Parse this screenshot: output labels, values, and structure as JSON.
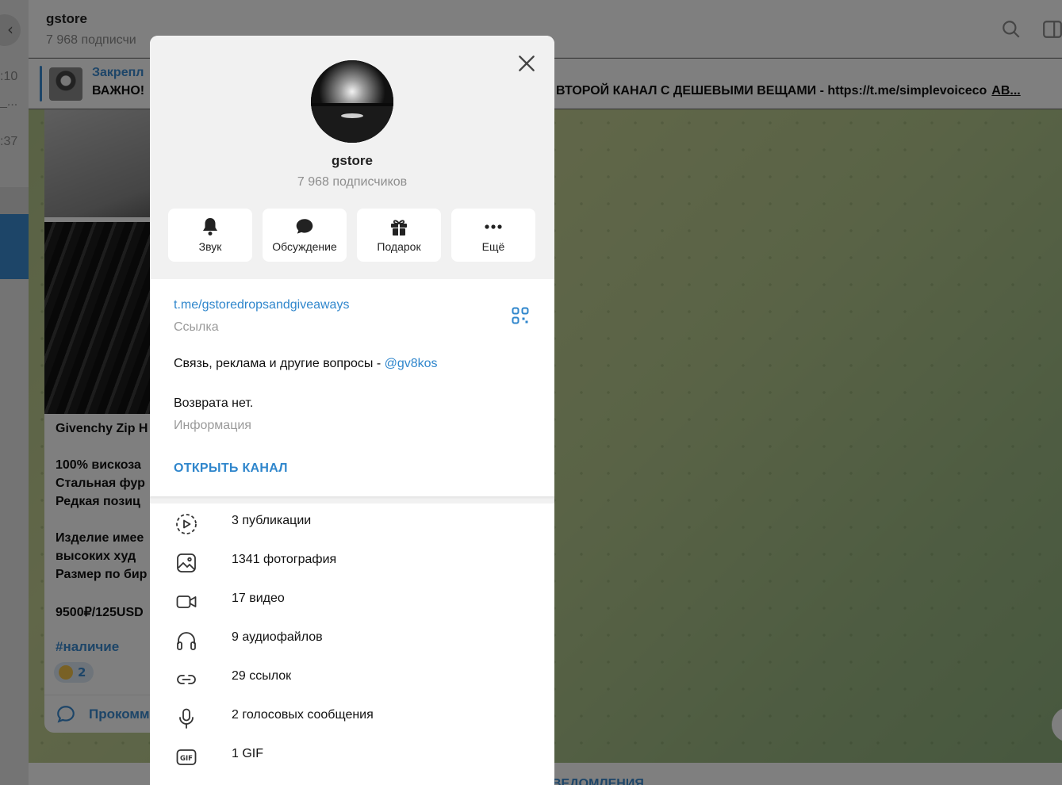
{
  "background": {
    "left_items": [
      ":10",
      "_...",
      ":37"
    ],
    "chat": {
      "title": "gstore",
      "subtitle": "7 968 подписчи"
    },
    "pinned": {
      "title": "Закрепл",
      "message": "ВАЖНО!",
      "message_tail": "ВТОРОЙ КАНАЛ С ДЕШЕВЫМИ ВЕЩАМИ - https://t.me/simplevoiceco",
      "message_more": "АВ..."
    },
    "post": {
      "lines": [
        "Givenchy Zip H",
        "100% вискоза",
        "Стальная фур",
        "Редкая позиц",
        "Изделие имее",
        "высоких худ",
        "Размер по бир",
        "9500₽/125USD"
      ],
      "hashtag": "#наличие",
      "reaction_count": "2",
      "comment_label": "Прокомм"
    },
    "bottom_bar_label": "ВЕДОМЛЕНИЯ"
  },
  "modal": {
    "title": "gstore",
    "subtitle": "7 968 подписчиков",
    "actions": [
      {
        "label": "Звук",
        "icon": "bell-icon"
      },
      {
        "label": "Обсуждение",
        "icon": "chat-bubble-icon"
      },
      {
        "label": "Подарок",
        "icon": "gift-icon"
      },
      {
        "label": "Ещё",
        "icon": "more-dots-icon"
      }
    ],
    "link": "t.me/gstoredropsandgiveaways",
    "link_label": "Ссылка",
    "description_line1": "Связь, реклама и другие вопросы - ",
    "description_mention": "@gv8kos",
    "description_line2": "Возврата нет.",
    "info_label": "Информация",
    "open_channel": "ОТКРЫТЬ КАНАЛ",
    "media": [
      {
        "label": "3 публикации",
        "icon": "stories-icon"
      },
      {
        "label": "1341 фотография",
        "icon": "photo-icon"
      },
      {
        "label": "17 видео",
        "icon": "video-icon"
      },
      {
        "label": "9 аудиофайлов",
        "icon": "headphones-icon"
      },
      {
        "label": "29 ссылок",
        "icon": "link-icon"
      },
      {
        "label": "2 голосовых сообщения",
        "icon": "microphone-icon"
      },
      {
        "label": "1 GIF",
        "icon": "gif-icon"
      }
    ]
  }
}
